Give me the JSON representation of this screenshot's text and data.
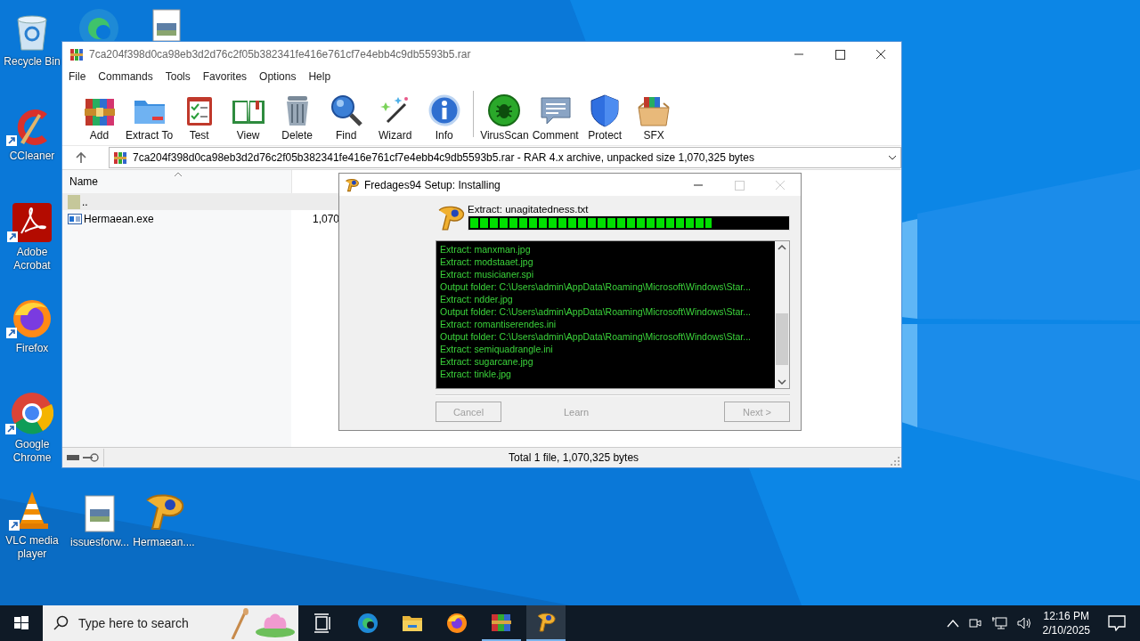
{
  "desktop": {
    "icons": [
      {
        "label": "Recycle Bin",
        "shortcut": false
      },
      {
        "label": "CCleaner",
        "shortcut": true
      },
      {
        "label": "Adobe Acrobat",
        "shortcut": true
      },
      {
        "label": "Firefox",
        "shortcut": true
      },
      {
        "label": "Google Chrome",
        "shortcut": true
      },
      {
        "label": "VLC media player",
        "shortcut": true
      },
      {
        "label": "issuesforw...",
        "shortcut": false
      },
      {
        "label": "Hermaean....",
        "shortcut": false
      }
    ]
  },
  "winrar": {
    "title": "7ca204f398d0ca98eb3d2d76c2f05b382341fe416e761cf7e4ebb4c9db5593b5.rar",
    "menu": [
      "File",
      "Commands",
      "Tools",
      "Favorites",
      "Options",
      "Help"
    ],
    "toolbar": [
      "Add",
      "Extract To",
      "Test",
      "View",
      "Delete",
      "Find",
      "Wizard",
      "Info",
      "VirusScan",
      "Comment",
      "Protect",
      "SFX"
    ],
    "address": "7ca204f398d0ca98eb3d2d76c2f05b382341fe416e761cf7e4ebb4c9db5593b5.rar - RAR 4.x archive, unpacked size 1,070,325 bytes",
    "columns": [
      "Name"
    ],
    "rows": [
      {
        "name": "..",
        "size": "",
        "kind": "folder",
        "selected": true
      },
      {
        "name": "Hermaean.exe",
        "size": "1,070",
        "kind": "exe",
        "selected": false
      }
    ],
    "status_bar": "Total 1 file, 1,070,325 bytes"
  },
  "dialog": {
    "title": "Fredages94 Setup: Installing",
    "title_controls": [
      {
        "disabled": false
      },
      {
        "disabled": true
      },
      {
        "disabled": true
      }
    ],
    "status": "Extract: unagitatedness.txt",
    "level": 0.76,
    "log": [
      "Extract: manxman.jpg",
      "Extract: modstaaet.jpg",
      "Extract: musicianer.spi",
      "Output folder: C:\\Users\\admin\\AppData\\Roaming\\Microsoft\\Windows\\Star...",
      "Extract: ndder.jpg",
      "Output folder: C:\\Users\\admin\\AppData\\Roaming\\Microsoft\\Windows\\Star...",
      "Extract: romantiserendes.ini",
      "Output folder: C:\\Users\\admin\\AppData\\Roaming\\Microsoft\\Windows\\Star...",
      "Extract: semiquadrangle.ini",
      "Extract: sugarcane.jpg",
      "Extract: tinkle.jpg"
    ],
    "buttons": [
      {
        "label": "Cancel",
        "disabled": true
      },
      {
        "label": "Next >",
        "disabled": true
      }
    ],
    "brand": "Learn"
  },
  "taskbar": {
    "search_placeholder": "Type here to search",
    "apps": [
      {
        "running": false,
        "selected": false
      },
      {
        "running": false,
        "selected": false
      },
      {
        "running": false,
        "selected": false
      },
      {
        "running": false,
        "selected": false
      },
      {
        "running": true,
        "selected": false
      },
      {
        "running": true,
        "selected": true
      }
    ],
    "time": "12:16 PM",
    "date": "2/10/2025"
  }
}
